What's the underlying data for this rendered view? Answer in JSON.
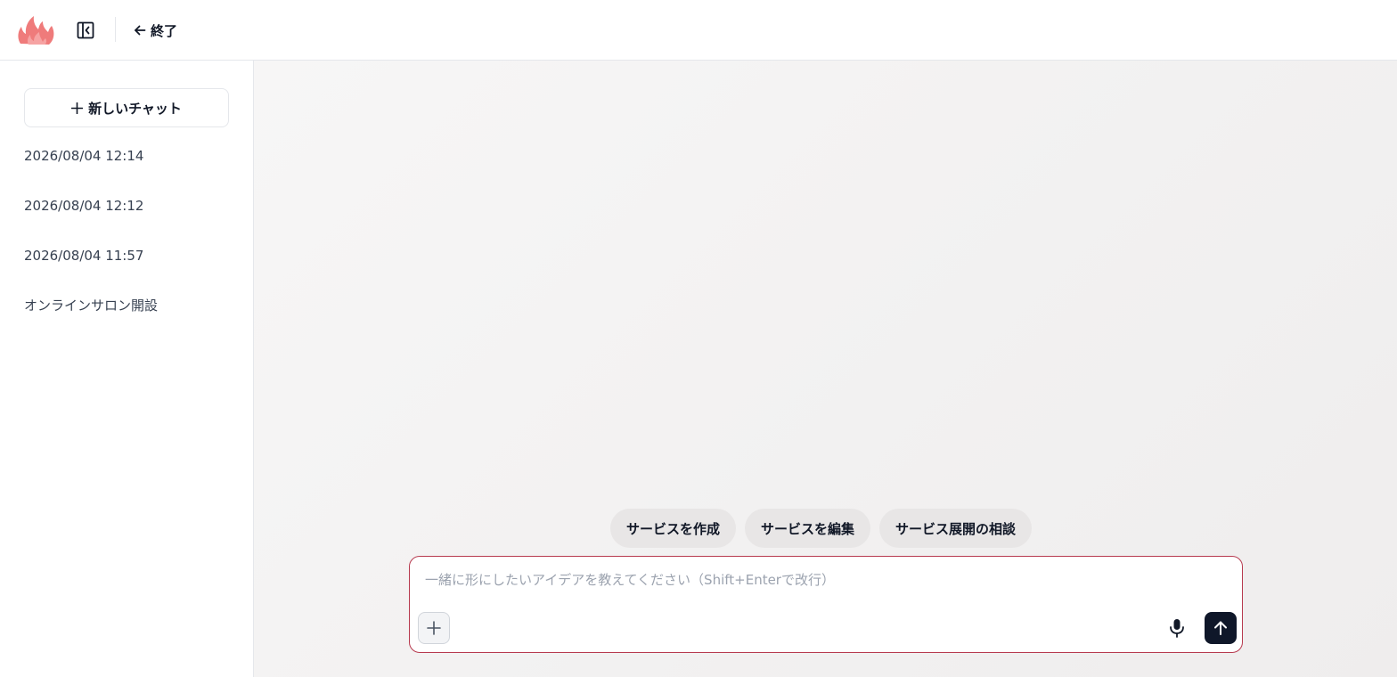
{
  "header": {
    "exit_label": "終了"
  },
  "sidebar": {
    "new_chat_label": "新しいチャット",
    "history": [
      {
        "label": "2026/08/04 12:14"
      },
      {
        "label": "2026/08/04 12:12"
      },
      {
        "label": "2026/08/04 11:57"
      },
      {
        "label": "オンラインサロン開設"
      }
    ]
  },
  "main": {
    "suggestions": [
      {
        "label": "サービスを作成"
      },
      {
        "label": "サービスを編集"
      },
      {
        "label": "サービス展開の相談"
      }
    ],
    "composer": {
      "placeholder": "一緒に形にしたいアイデアを教えてください（Shift+Enterで改行）",
      "value": ""
    }
  },
  "icons": {
    "logo": "flame-logo",
    "sidebar_toggle": "sidebar-collapse-icon",
    "exit": "arrow-left-icon",
    "new_chat": "plus-icon",
    "attach": "plus-icon",
    "mic": "microphone-icon",
    "send": "arrow-up-icon"
  },
  "colors": {
    "brand_flame": "#ef7b7b",
    "composer_border": "#b73a4f",
    "send_button": "#0f1729",
    "chip_bg": "#e8e6e6"
  }
}
